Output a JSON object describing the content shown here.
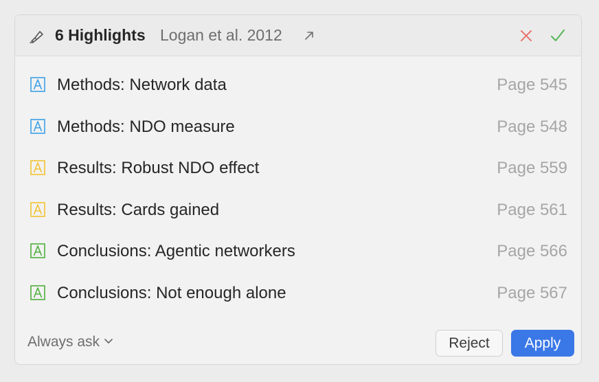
{
  "header": {
    "title": "6 Highlights",
    "source": "Logan et al. 2012",
    "icons": {
      "pen": "highlighter-icon",
      "external": "external-link-icon",
      "reject": "close-icon",
      "accept": "checkmark-icon"
    },
    "colors": {
      "reject": "#e8736b",
      "accept": "#5cb85c"
    }
  },
  "highlights": [
    {
      "label": "Methods: Network data",
      "page": "Page 545",
      "color": "#3ba0e6"
    },
    {
      "label": "Methods: NDO measure",
      "page": "Page 548",
      "color": "#3ba0e6"
    },
    {
      "label": "Results: Robust NDO effect",
      "page": "Page 559",
      "color": "#f2c230"
    },
    {
      "label": "Results: Cards gained",
      "page": "Page 561",
      "color": "#f2c230"
    },
    {
      "label": "Conclusions: Agentic networkers",
      "page": "Page 566",
      "color": "#4fae3c"
    },
    {
      "label": "Conclusions: Not enough alone",
      "page": "Page 567",
      "color": "#4fae3c"
    }
  ],
  "footer": {
    "mode_label": "Always ask",
    "reject_label": "Reject",
    "apply_label": "Apply",
    "apply_color": "#3b78e7"
  }
}
